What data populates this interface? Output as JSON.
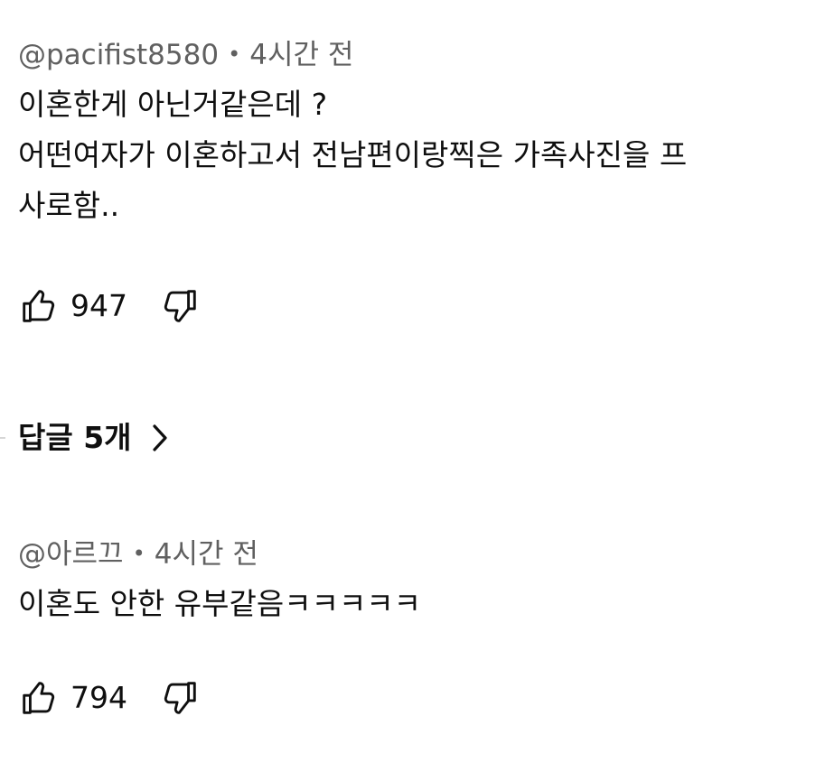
{
  "comments": [
    {
      "author": "@pacifist8580",
      "separator": "•",
      "time": "4시간 전",
      "lines": [
        "이혼한게 아닌거같은데 ?",
        "어떤여자가 이혼하고서 전남편이랑찍은 가족사진을 프",
        "사로함.."
      ],
      "likes": "947"
    },
    {
      "author": "@아르끄",
      "separator": "•",
      "time": "4시간 전",
      "lines": [
        "이혼도 안한 유부같음ㅋㅋㅋㅋㅋ"
      ],
      "likes": "794"
    }
  ],
  "replies": {
    "label": "답글 5개"
  },
  "icons": {
    "like": "thumbs-up-icon",
    "dislike": "thumbs-down-icon",
    "replies_chevron": "chevron-right-icon"
  },
  "colors": {
    "text": "#0f0f0f",
    "meta": "#606060",
    "background": "#ffffff"
  }
}
